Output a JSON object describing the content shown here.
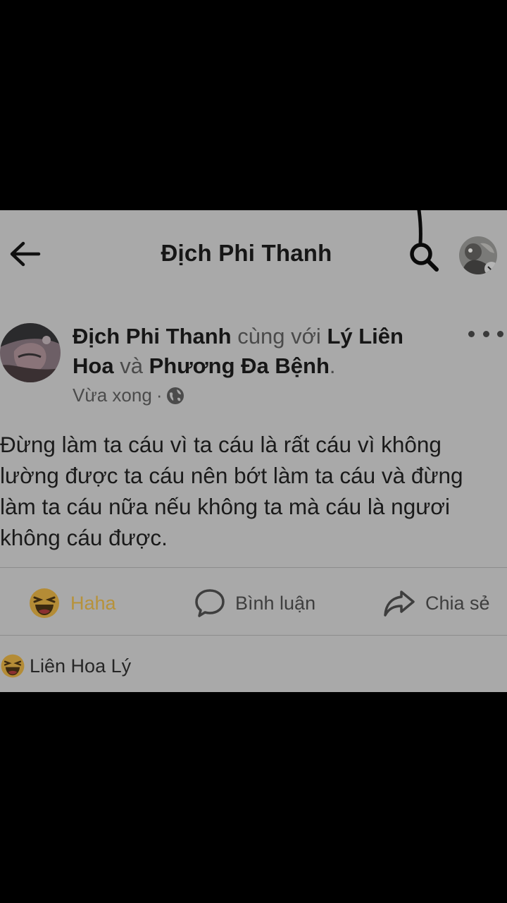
{
  "header": {
    "title": "Địch Phi Thanh",
    "back_icon": "arrow-left-icon",
    "search_icon": "search-icon",
    "avatar_icon": "profile-avatar"
  },
  "post": {
    "author": "Địch Phi Thanh",
    "with_text": "cùng với",
    "tag1_line1": "Lý Liên",
    "tag1_line2": "Hoa",
    "and_text": "và",
    "tag2": "Phương Đa Bệnh",
    "period": ".",
    "time": "Vừa xong",
    "separator": "·",
    "privacy_icon": "globe-icon",
    "body_lines": [
      "Đừng làm ta cáu vì ta cáu là rất cáu vì không",
      "lường được ta cáu nên bớt làm ta cáu và đừng",
      "làm ta cáu nữa nếu không ta mà cáu là ngươi",
      "không cáu được."
    ]
  },
  "actions": {
    "haha_label": "Haha",
    "comment_label": "Bình luận",
    "share_label": "Chia sẻ",
    "haha_color": "#b7923a"
  },
  "reactions": {
    "icon": "haha-emoji-icon",
    "people": "Liên Hoa Lý"
  },
  "colors": {
    "background": "#000000",
    "card": "#a9a9a9",
    "text": "#161616"
  }
}
